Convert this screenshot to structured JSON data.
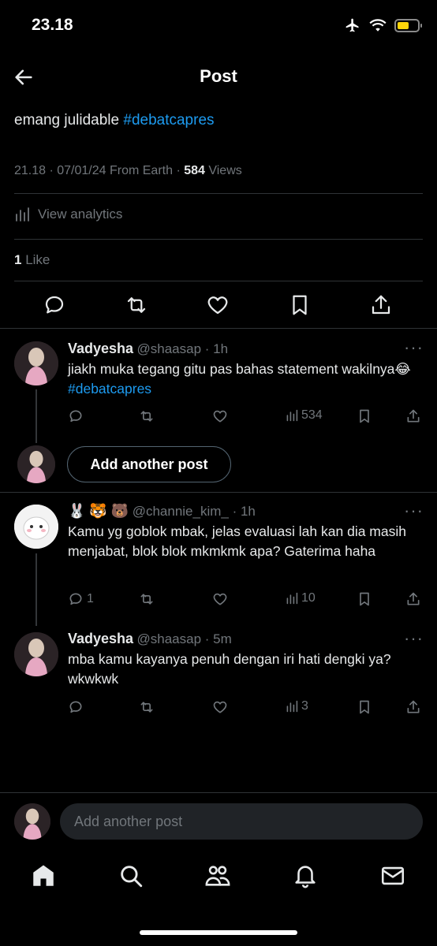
{
  "status": {
    "time": "23.18"
  },
  "header": {
    "title": "Post"
  },
  "tweet": {
    "text_prefix": "emang  julidable ",
    "hashtag": "#debatcapres",
    "meta_prefix": "21.18 · 07/01/24 From Earth · ",
    "views_count": "584",
    "views_label": " Views",
    "analytics_label": "View analytics",
    "likes_count": "1",
    "likes_label": " Like"
  },
  "replies": [
    {
      "name": "Vadyesha",
      "handle": "@shaasap · 1h",
      "text": "jiakh muka tegang gitu pas bahas statement wakilnya😂 ",
      "hashtag": "#debatcapres",
      "reply_count": "",
      "views": "534"
    },
    {
      "name_emoji": "🐰 🐯 🐻",
      "handle": "@channie_kim_ · 1h",
      "text": "Kamu yg goblok mbak, jelas evaluasi lah kan dia masih menjabat, blok blok mkmkmk apa? Gaterima haha",
      "reply_count": "1",
      "views": "10"
    },
    {
      "name": "Vadyesha",
      "handle": "@shaasap · 5m",
      "text": "mba kamu kayanya penuh dengan iri hati dengki ya? wkwkwk",
      "reply_count": "",
      "views": "3"
    }
  ],
  "add_another_post_label": "Add another post",
  "reply_placeholder": "Add another post",
  "colors": {
    "accent": "#1d9bf0",
    "background": "#000000",
    "muted": "#71767b",
    "battery": "#ffd60a"
  }
}
